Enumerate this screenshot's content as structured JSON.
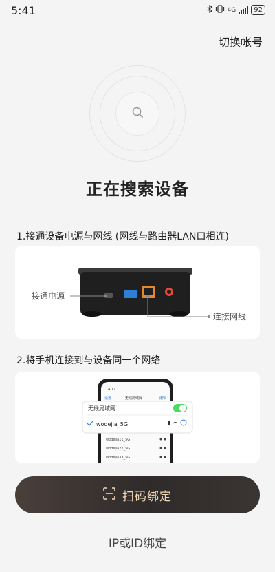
{
  "status_bar": {
    "time": "5:41",
    "network": "4G",
    "battery": "92"
  },
  "header": {
    "switch_account": "切换帐号"
  },
  "main": {
    "title": "正在搜索设备",
    "step1": {
      "text": "1.接通设备电源与网线 (网线与路由器LAN口相连)",
      "label_power": "接通电源",
      "label_network": "连接网线"
    },
    "step2": {
      "text": "2.将手机连接到与设备同一个网络",
      "phone_time": "14:11",
      "phone_back": "设置",
      "phone_title": "无线局域网",
      "phone_edit": "编辑",
      "wlan_label": "无线局域网",
      "connected_network": "wodejia_5G",
      "networks": [
        "wodejia11_5G",
        "wodejia22_5G",
        "wodejia33_5G"
      ]
    }
  },
  "actions": {
    "scan_bind": "扫码绑定",
    "ip_bind": "IP或ID绑定"
  },
  "colors": {
    "accent_gold": "#f1d9b4",
    "button_dark": "#2f2b2a",
    "toggle_green": "#4cd964",
    "ethernet_orange": "#e8862a",
    "usb_blue": "#2f7fd6",
    "power_red": "#e04a3a"
  }
}
